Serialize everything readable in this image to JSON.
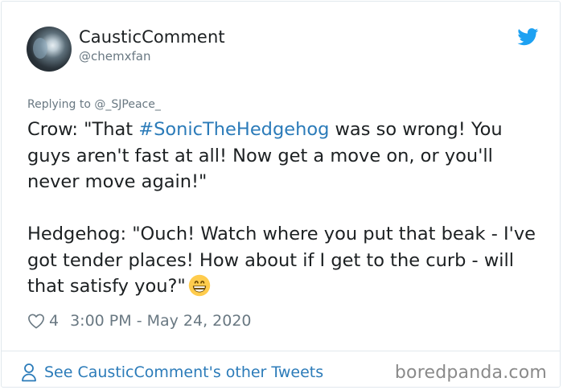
{
  "author": {
    "display_name": "CausticComment",
    "handle": "@chemxfan"
  },
  "icons": {
    "brand": "twitter-bird-icon",
    "like": "heart-icon",
    "profile": "person-icon",
    "emoji": "grinning-face-emoji"
  },
  "colors": {
    "link": "#2b7bb9",
    "twitter_blue": "#1da1f2",
    "secondary_text": "#697882"
  },
  "reply": {
    "text": "Replying to @_SJPeace_"
  },
  "tweet": {
    "part1": "Crow: \"That ",
    "hashtag": "#SonicTheHedgehog",
    "part2": " was so wrong! You guys aren't fast at all! Now get a move on, or you'll never move again!\"\n\nHedgehog: \"Ouch! Watch where you put that beak - I've got tender places! How about if I get to the curb - will that satisfy you?\""
  },
  "meta": {
    "likes": "4",
    "timestamp": "3:00 PM - May 24, 2020"
  },
  "footer": {
    "see_other_label": "See CausticComment's other Tweets",
    "watermark": "boredpanda.com"
  }
}
